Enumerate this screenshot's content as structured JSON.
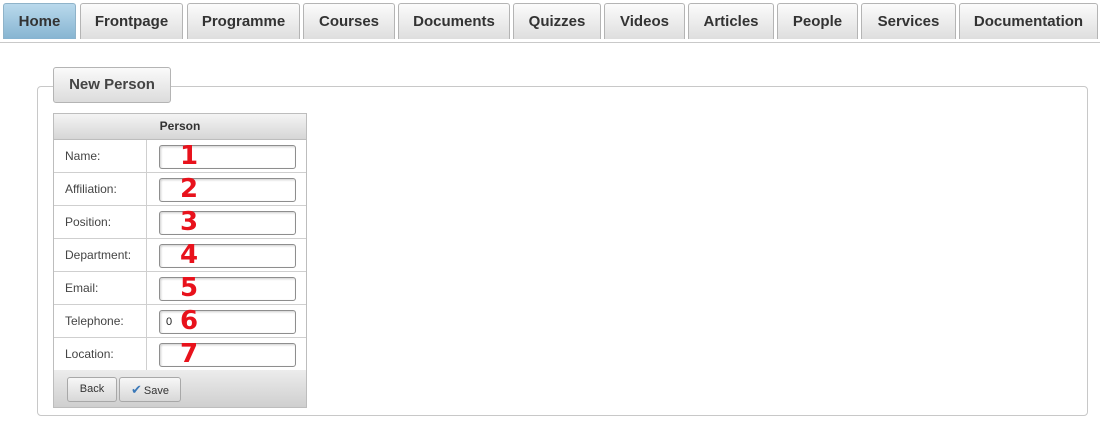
{
  "nav": {
    "tabs": [
      {
        "label": "Home",
        "active": true
      },
      {
        "label": "Frontpage"
      },
      {
        "label": "Programme"
      },
      {
        "label": "Courses"
      },
      {
        "label": "Documents"
      },
      {
        "label": "Quizzes"
      },
      {
        "label": "Videos"
      },
      {
        "label": "Articles"
      },
      {
        "label": "People"
      },
      {
        "label": "Services"
      },
      {
        "label": "Documentation"
      }
    ]
  },
  "panel": {
    "legend": "New Person"
  },
  "form": {
    "header": "Person",
    "fields": [
      {
        "label": "Name:",
        "value": "",
        "marker": "1"
      },
      {
        "label": "Affiliation:",
        "value": "",
        "marker": "2"
      },
      {
        "label": "Position:",
        "value": "",
        "marker": "3"
      },
      {
        "label": "Department:",
        "value": "",
        "marker": "4"
      },
      {
        "label": "Email:",
        "value": "",
        "marker": "5"
      },
      {
        "label": "Telephone:",
        "value": "0",
        "marker": "6"
      },
      {
        "label": "Location:",
        "value": "",
        "marker": "7"
      }
    ],
    "back_label": "Back",
    "save_label": "Save"
  },
  "colors": {
    "active_tab": "#9cc6e0",
    "marker": "#e8121c",
    "save_check": "#3a78b8"
  },
  "icons": {
    "save": "check-icon"
  }
}
